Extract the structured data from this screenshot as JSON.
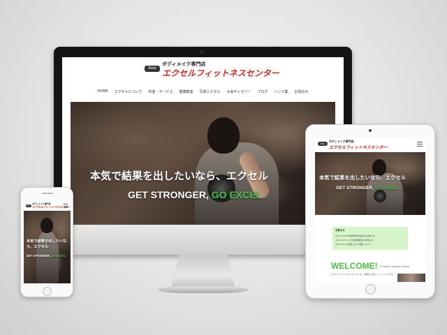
{
  "site": {
    "logo_mark": "Body Make",
    "logo_small": "ボディメイク専門店",
    "logo_big": "エクセルフィットネスセンター"
  },
  "nav": {
    "items": [
      "HOME",
      "エクセルについて",
      "料金・サービス",
      "健康教室",
      "写真エクセル",
      "大会ギャラリー",
      "ブログ",
      "リンク集",
      "お問合せ"
    ]
  },
  "hero": {
    "headline_jp": "本気で結果を出したいなら、エクセル",
    "headline_en_white": "GET STRONGER,",
    "headline_en_green": "GO EXCEL"
  },
  "news": {
    "title": "お知らせ",
    "items": [
      "2021.11.08  年末年始の休館日のお知らせ",
      "2021.11.04  11月の健康教室のお知らせ",
      "2021.10.25  新型コロナ対策について"
    ]
  },
  "welcome": {
    "title": "WELCOME!",
    "subtitle": "I'T'S EXCEL FITNESS CENTER",
    "text": "エクセルフィットネスセンターは、健康のためにトレーニングする"
  },
  "colors": {
    "accent_red": "#d8231c",
    "accent_green": "#4cc24c",
    "news_bg": "#d6f5c9"
  }
}
